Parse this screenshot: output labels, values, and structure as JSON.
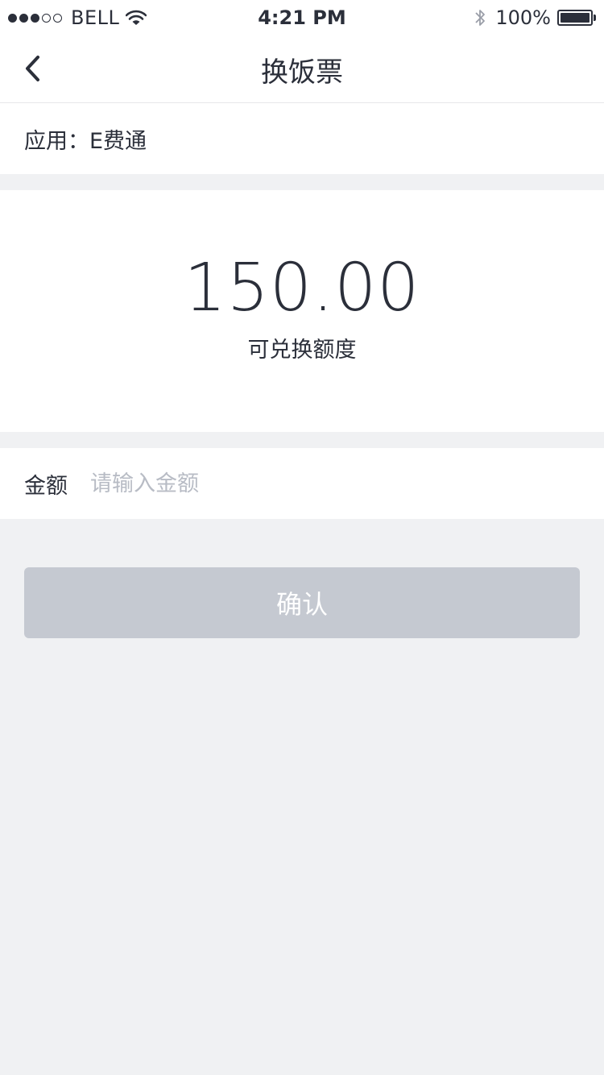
{
  "status_bar": {
    "carrier": "BELL",
    "time": "4:21 PM",
    "battery": "100%",
    "signal_full": 3,
    "signal_total": 5
  },
  "nav": {
    "title": "换饭票",
    "back_icon": "chevron-left-icon"
  },
  "app_row": {
    "label": "应用：E费通"
  },
  "quota": {
    "value": "150.00",
    "label": "可兑换额度"
  },
  "amount_field": {
    "label": "金额",
    "value": "",
    "placeholder": "请输入金额"
  },
  "confirm_button": {
    "label": "确认"
  },
  "colors": {
    "background": "#f0f1f3",
    "text": "#2b2f3a",
    "placeholder": "#b8bcc5",
    "button_disabled": "#c5c9d1"
  }
}
